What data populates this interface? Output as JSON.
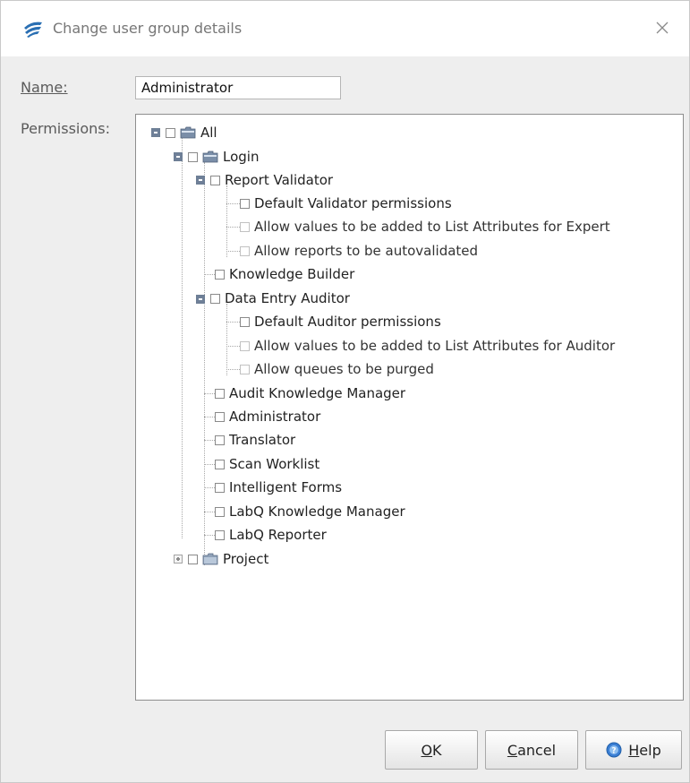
{
  "window": {
    "title": "Change user group details",
    "close_glyph": "✕"
  },
  "form": {
    "name_label": "Name:",
    "name_value": "Administrator",
    "permissions_label": "Permissions:"
  },
  "tree": {
    "root": "All",
    "login": "Login",
    "report_validator": "Report Validator",
    "rv_default": "Default Validator permissions",
    "rv_allow_values": "Allow values to be added to List Attributes for Expert",
    "rv_allow_reports": "Allow reports to be autovalidated",
    "knowledge_builder": "Knowledge Builder",
    "data_entry_auditor": "Data Entry Auditor",
    "dea_default": "Default Auditor permissions",
    "dea_allow_values": "Allow values to be added to List Attributes for Auditor",
    "dea_allow_purge": "Allow queues to be purged",
    "audit_knowledge_manager": "Audit Knowledge Manager",
    "administrator": "Administrator",
    "translator": "Translator",
    "scan_worklist": "Scan Worklist",
    "intelligent_forms": "Intelligent Forms",
    "labq_knowledge_manager": "LabQ Knowledge Manager",
    "labq_reporter": "LabQ Reporter",
    "project": "Project"
  },
  "buttons": {
    "ok_mnemonic": "O",
    "ok_rest": "K",
    "cancel_mnemonic": "C",
    "cancel_rest": "ancel",
    "help_mnemonic": "H",
    "help_rest": "elp"
  },
  "colors": {
    "title_text": "#777777",
    "panel_border": "#8e8e8e",
    "dialog_bg": "#eeeeee"
  },
  "icons": {
    "app": "app-logo-icon",
    "close": "close-icon",
    "folder": "folder-icon",
    "help": "help-icon"
  }
}
